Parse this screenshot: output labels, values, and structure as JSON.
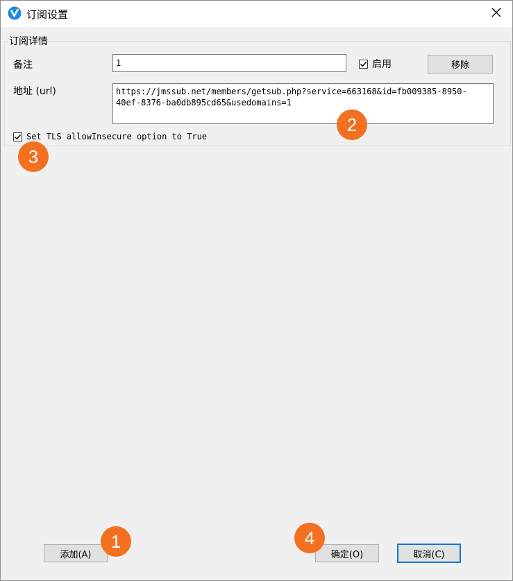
{
  "window": {
    "title": "订阅设置"
  },
  "group": {
    "title": "订阅详情"
  },
  "form": {
    "remark_label": "备注",
    "remark_value": "1",
    "enable_label": "启用",
    "remove_button": "移除",
    "url_label": "地址 (url)",
    "url_value": "https://jmssub.net/members/getsub.php?service=663168&id=fb009385-8950-40ef-8376-ba0db895cd65&usedomains=1",
    "tls_label": "Set TLS allowInsecure option to True"
  },
  "footer": {
    "add_button": "添加(A)",
    "ok_button": "确定(O)",
    "cancel_button": "取消(C)"
  },
  "badges": [
    "1",
    "2",
    "3",
    "4"
  ],
  "colors": {
    "badge": "#f37021",
    "accent": "#0078d7",
    "icon": "#1e88e5"
  },
  "icons": {
    "app": "v2ray-icon",
    "close": "close-icon",
    "check": "check-icon"
  }
}
